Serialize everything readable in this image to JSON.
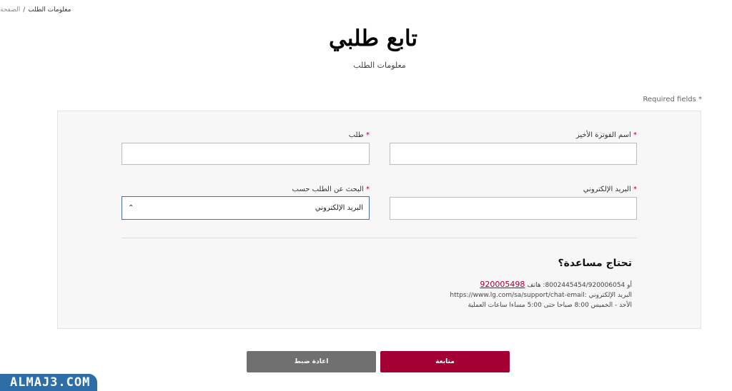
{
  "breadcrumb": {
    "home": "الصفحة",
    "separator": "/",
    "current": "معلومات الطلب"
  },
  "title": "تابع طلبي",
  "subtitle": "معلومات الطلب",
  "required_note": "Required fields *",
  "form": {
    "last_invoice": {
      "label": "اسم الفوترة الأخير",
      "value": ""
    },
    "order": {
      "label": "طلب",
      "value": ""
    },
    "email": {
      "label": "البريد الإلكتروني",
      "value": ""
    },
    "search_by": {
      "label": "البحث عن الطلب حسب",
      "selected": "البريد الإلكتروني"
    },
    "required_star": "*"
  },
  "help": {
    "title": "تحتاج مساعدة؟",
    "phone_prefix": "أو 8002445454/920006054: هاتف",
    "phone_link": "920005498",
    "email_line": "البريد الإلكتروني :https://www.lg.com/sa/support/chat-email",
    "hours_line": "الأحد - الخميس 8:00 صباحا حتى 5:00 مساءا ساعات العملية"
  },
  "buttons": {
    "reset": "اعادة ضبط",
    "continue": "متابعة"
  },
  "watermark": "ALMAJ3.COM",
  "colors": {
    "accent": "#a50034",
    "reset": "#707070",
    "panel": "#f7f7f7",
    "watermark": "#2d6ea8"
  }
}
